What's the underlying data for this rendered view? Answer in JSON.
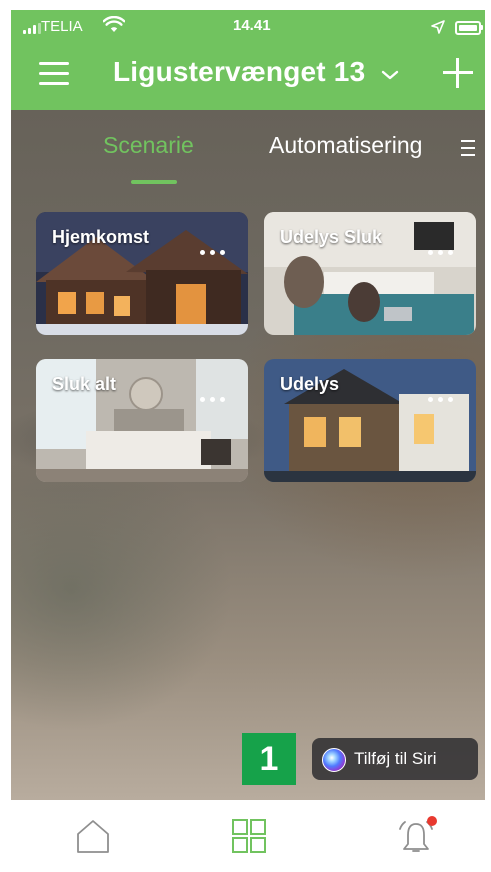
{
  "status_bar": {
    "carrier": "TELIA",
    "time": "14.41"
  },
  "header": {
    "title": "Ligustervænget 13"
  },
  "tabs": [
    {
      "label": "Scenarie",
      "active": true
    },
    {
      "label": "Automatisering",
      "active": false
    }
  ],
  "scenes": [
    {
      "label": "Hjemkomst"
    },
    {
      "label": "Udelys Sluk"
    },
    {
      "label": "Sluk alt"
    },
    {
      "label": "Udelys"
    }
  ],
  "annotation_badge": "1",
  "siri_button": {
    "label": "Tilføj til Siri"
  },
  "bottom_nav": [
    {
      "icon": "home-icon",
      "active": false
    },
    {
      "icon": "grid-icon",
      "active": true
    },
    {
      "icon": "bell-icon",
      "active": false,
      "has_notification": true
    }
  ],
  "colors": {
    "accent": "#71c35f",
    "badge": "#16a24a",
    "notification": "#e8392f"
  }
}
